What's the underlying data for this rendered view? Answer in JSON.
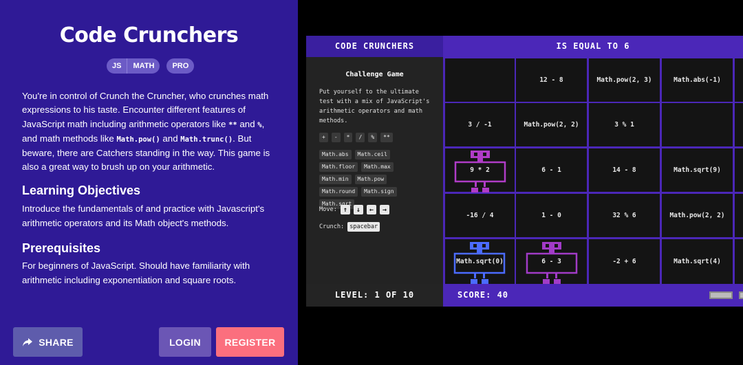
{
  "course": {
    "title": "Code Crunchers",
    "tags": [
      "JS",
      "MATH",
      "PRO"
    ],
    "description": {
      "p1": "You're in control of Crunch the Cruncher, who crunches math expressions to his taste. Encounter different features of JavaScript math including arithmetic operators like ",
      "c1": "**",
      "p2": " and ",
      "c2": "%",
      "p3": ", and math methods like ",
      "c3": "Math.pow()",
      "p4": " and ",
      "c4": "Math.trunc()",
      "p5": ". But beware, there are Catchers standing in the way. This game is also a great way to brush up on your arithmetic."
    },
    "objectives_heading": "Learning Objectives",
    "objectives_text": "Introduce the fundamentals of and practice with Javascript's arithmetic operators and its Math object's methods.",
    "prereq_heading": "Prerequisites",
    "prereq_text": "For beginners of JavaScript. Should have familiarity with arithmetic including exponentiation and square roots."
  },
  "buttons": {
    "share": "SHARE",
    "login": "LOGIN",
    "register": "REGISTER"
  },
  "game": {
    "header_left": "CODE CRUNCHERS",
    "header_right": "IS EQUAL TO 6",
    "side_title": "Challenge Game",
    "side_desc": "Put yourself to the ultimate test with a mix of JavaScript's arithmetic operators and math methods.",
    "operators": [
      "+",
      "-",
      "*",
      "/",
      "%",
      "**"
    ],
    "methods": [
      "Math.abs",
      "Math.ceil",
      "Math.floor",
      "Math.max",
      "Math.min",
      "Math.pow",
      "Math.round",
      "Math.sign",
      "Math.sqrt"
    ],
    "move_label": "Move:",
    "move_keys": [
      "↑",
      "↓",
      "←",
      "→"
    ],
    "crunch_label": "Crunch:",
    "crunch_key": "spacebar",
    "level": "LEVEL: 1 OF 10",
    "score": "SCORE: 40",
    "cells": [
      [
        "",
        "12 - 8",
        "Math.pow(2, 3)",
        "Math.abs(-1)"
      ],
      [
        "3 / -1",
        "Math.pow(2, 2)",
        "3 % 1",
        ""
      ],
      [
        "9 * 2",
        "6 - 1",
        "14 - 8",
        "Math.sqrt(9)"
      ],
      [
        "-16 / 4",
        "1 - 0",
        "32 % 6",
        "Math.pow(2, 2)"
      ],
      [
        "Math.sqrt(0)",
        "6 - 3",
        "-2 + 6",
        "Math.sqrt(4)"
      ]
    ],
    "colors": {
      "grid": "#4b27b8",
      "cruncher": "#b03cc7",
      "catcher": "#4b6bff",
      "catcher2": "#a13bc7"
    }
  }
}
